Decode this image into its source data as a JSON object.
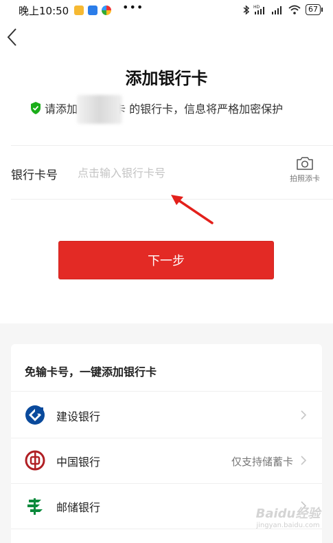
{
  "status_bar": {
    "time": "晚上10:50",
    "more": "•••",
    "battery": "67",
    "icons": [
      "bluetooth-icon",
      "hd-signal-icon",
      "signal-icon",
      "wifi-icon",
      "battery-icon"
    ]
  },
  "header": {
    "title": "添加银行卡",
    "subtitle_prefix": "请添加",
    "subtitle_suffix": "卡 的银行卡，信息将严格加密保护"
  },
  "card_input": {
    "label": "银行卡号",
    "placeholder": "点击输入银行卡号",
    "value": "",
    "camera_label": "拍照添卡"
  },
  "next_button": {
    "label": "下一步"
  },
  "bank_list": {
    "heading": "免输卡号，一键添加银行卡",
    "items": [
      {
        "name": "建设银行",
        "note": "",
        "icon": "ccb-logo-icon"
      },
      {
        "name": "中国银行",
        "note": "仅支持储蓄卡",
        "icon": "boc-logo-icon"
      },
      {
        "name": "邮储银行",
        "note": "",
        "icon": "psbc-logo-icon"
      }
    ]
  },
  "watermark": {
    "line1": "Baidu经验",
    "line2": "jingyan.baidu.com"
  },
  "colors": {
    "accent": "#e32a25",
    "shield": "#1aad19",
    "ccb": "#0a4a9c",
    "boc": "#b01f24",
    "psbc": "#0b8a3c"
  }
}
